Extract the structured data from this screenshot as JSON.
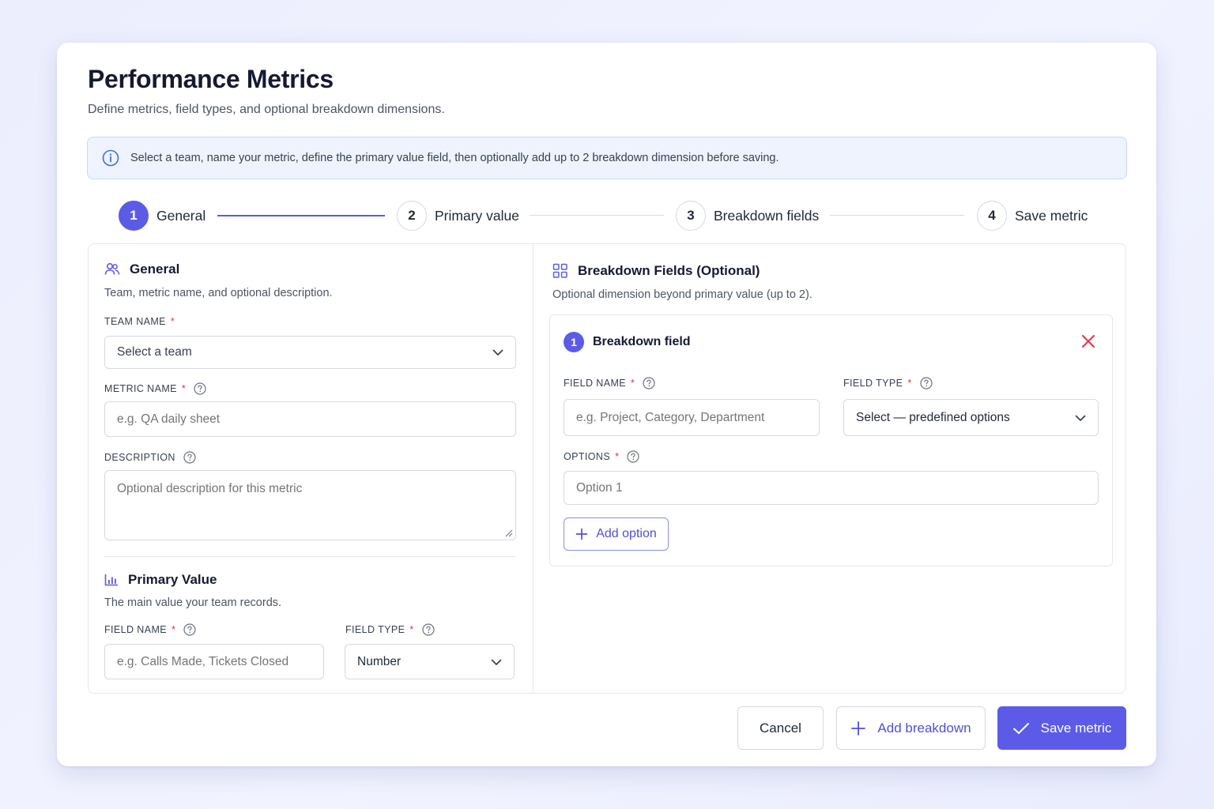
{
  "page": {
    "title": "Performance Metrics",
    "subtitle": "Define metrics, field types, and optional breakdown dimensions."
  },
  "info_banner": {
    "icon": "info-icon",
    "text": "Select a team, name your metric, define the primary value field, then optionally add up to 2 breakdown dimension before saving."
  },
  "stepper": {
    "steps": [
      {
        "number": "1",
        "label": "General",
        "active": true
      },
      {
        "number": "2",
        "label": "Primary value",
        "active": false
      },
      {
        "number": "3",
        "label": "Breakdown fields",
        "active": false
      },
      {
        "number": "4",
        "label": "Save metric",
        "active": false
      }
    ]
  },
  "general": {
    "icon": "users-icon",
    "title": "General",
    "description": "Team, metric name, and optional description.",
    "team_name_label": "Team name",
    "team_name_value": "Select a team",
    "metric_name_label": "Metric name",
    "metric_name_placeholder": "e.g. QA daily sheet",
    "description_label": "Description",
    "description_placeholder": "Optional description for this metric"
  },
  "primary_value": {
    "icon": "bar-chart-icon",
    "title": "Primary Value",
    "description": "The main value your team records.",
    "field_name_label": "Field name",
    "field_name_placeholder": "e.g. Calls Made, Tickets Closed",
    "field_type_label": "Field type",
    "field_type_value": "Number"
  },
  "breakdown": {
    "icon": "grid-icon",
    "title": "Breakdown Fields (Optional)",
    "description": "Optional dimension beyond primary value (up to 2).",
    "card": {
      "number": "1",
      "title": "Breakdown field",
      "field_name_label": "Field name",
      "field_name_placeholder": "e.g. Project, Category, Department",
      "field_type_label": "Field type",
      "field_type_value": "Select — predefined options",
      "options_label": "Options",
      "option_placeholder": "Option 1",
      "add_option_label": "Add option"
    }
  },
  "actions": {
    "cancel_label": "Cancel",
    "add_breakdown_label": "Add breakdown",
    "save_label": "Save metric"
  },
  "colors": {
    "accent": "#5b5be8",
    "required": "#e0334a",
    "remove": "#e0334a",
    "banner_bg": "#eef3fe"
  }
}
